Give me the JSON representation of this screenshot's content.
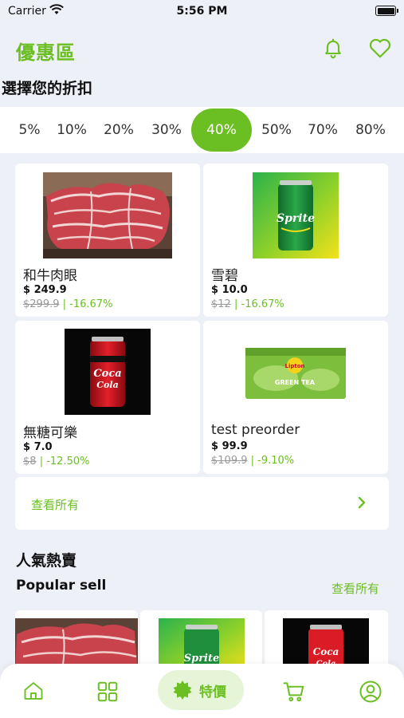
{
  "status": {
    "carrier": "Carrier",
    "time": "5:56 PM"
  },
  "header": {
    "title": "優惠區"
  },
  "section": {
    "title": "選擇您的折扣"
  },
  "discounts": [
    "5%",
    "10%",
    "20%",
    "30%",
    "40%",
    "50%",
    "70%",
    "80%"
  ],
  "active_discount": "40%",
  "products": [
    {
      "name": "和牛肉眼",
      "price": "$ 249.9",
      "old_price": "$299.9",
      "separator": "|",
      "pct": "-16.67%",
      "icon": "wagyu-beef-image"
    },
    {
      "name": "雪碧",
      "price": "$ 10.0",
      "old_price": "$12",
      "separator": "|",
      "pct": "-16.67%",
      "icon": "sprite-can-image"
    },
    {
      "name": "無糖可樂",
      "price": "$ 7.0",
      "old_price": "$8",
      "separator": "|",
      "pct": "-12.50%",
      "icon": "coke-zero-can-image"
    },
    {
      "name": "test preorder",
      "price": "$ 99.9",
      "old_price": "$109.9",
      "separator": "|",
      "pct": "-9.10%",
      "icon": "lipton-green-tea-box-image"
    }
  ],
  "view_all": {
    "label": "查看所有"
  },
  "popular": {
    "title": "人氣熱賣",
    "subtitle": "Popular sell",
    "more": "查看所有"
  },
  "tabbar": {
    "special_label": "特價"
  },
  "colors": {
    "accent": "#6bbf23",
    "background": "#eef0f7"
  }
}
